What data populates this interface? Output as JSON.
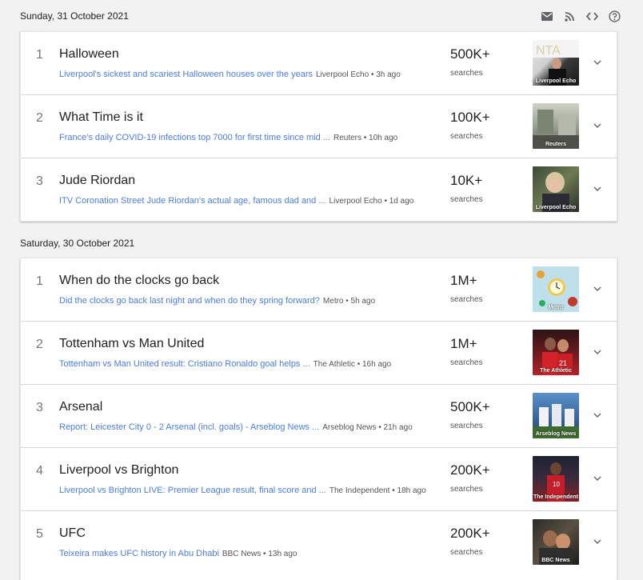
{
  "toolbar": {
    "icons": [
      "mail-icon",
      "rss-icon",
      "embed-code-icon",
      "help-icon"
    ]
  },
  "days": [
    {
      "date": "Sunday, 31 October 2021",
      "items": [
        {
          "rank": "1",
          "title": "Halloween",
          "article": "Liverpool's sickest and scariest Halloween houses over the years",
          "source": "Liverpool Echo • 3h ago",
          "count": "500K+",
          "count_label": "searches",
          "thumb_label": "Liverpool Echo"
        },
        {
          "rank": "2",
          "title": "What Time is it",
          "article": "France's daily COVID-19 infections top 7000 for first time since mid ...",
          "source": "Reuters • 10h ago",
          "count": "100K+",
          "count_label": "searches",
          "thumb_label": "Reuters"
        },
        {
          "rank": "3",
          "title": "Jude Riordan",
          "article": "ITV Coronation Street Jude Riordan's actual age, famous dad and ...",
          "source": "Liverpool Echo • 1d ago",
          "count": "10K+",
          "count_label": "searches",
          "thumb_label": "Liverpool Echo"
        }
      ]
    },
    {
      "date": "Saturday, 30 October 2021",
      "items": [
        {
          "rank": "1",
          "title": "When do the clocks go back",
          "article": "Did the clocks go back last night and when do they spring forward?",
          "source": "Metro • 5h ago",
          "count": "1M+",
          "count_label": "searches",
          "thumb_label": "Metro"
        },
        {
          "rank": "2",
          "title": "Tottenham vs Man United",
          "article": "Tottenham vs Man United result: Cristiano Ronaldo goal helps ...",
          "source": "The Athletic • 16h ago",
          "count": "1M+",
          "count_label": "searches",
          "thumb_label": "The Athletic"
        },
        {
          "rank": "3",
          "title": "Arsenal",
          "article": "Report: Leicester City 0 - 2 Arsenal (incl. goals) - Arseblog News ...",
          "source": "Arseblog News • 21h ago",
          "count": "500K+",
          "count_label": "searches",
          "thumb_label": "Arseblog News"
        },
        {
          "rank": "4",
          "title": "Liverpool vs Brighton",
          "article": "Liverpool vs Brighton LIVE: Premier League result, final score and ...",
          "source": "The Independent • 18h ago",
          "count": "200K+",
          "count_label": "searches",
          "thumb_label": "The Independent"
        },
        {
          "rank": "5",
          "title": "UFC",
          "article": "Teixeira makes UFC history in Abu Dhabi",
          "source": "BBC News • 13h ago",
          "count": "200K+",
          "count_label": "searches",
          "thumb_label": "BBC News"
        }
      ]
    }
  ],
  "colors": {
    "link": "#4a7dd8",
    "background": "#f2f2f2",
    "card": "#ffffff"
  }
}
